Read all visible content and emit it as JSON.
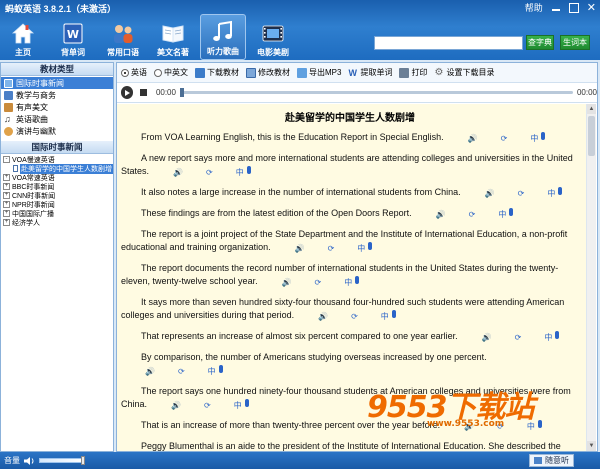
{
  "app": {
    "title": "蚂蚁英语 3.8.2.1（未激活）",
    "help": "帮助"
  },
  "toolbar": [
    {
      "label": "主页",
      "icon": "home-icon"
    },
    {
      "label": "背单词",
      "icon": "word-book-icon"
    },
    {
      "label": "常用口语",
      "icon": "people-chat-icon"
    },
    {
      "label": "美文名著",
      "icon": "book-icon"
    },
    {
      "label": "听力歌曲",
      "icon": "music-note-icon",
      "active": true
    },
    {
      "label": "电影美剧",
      "icon": "film-icon"
    }
  ],
  "search": {
    "placeholder": "",
    "btn_dict": "查字典",
    "btn_mood": "生词本"
  },
  "left": {
    "section_title": "教材类型",
    "categories": [
      {
        "label": "国际时事新闻",
        "selected": true
      },
      {
        "label": "教学与商务"
      },
      {
        "label": "有声美文"
      },
      {
        "label": "英语歌曲"
      },
      {
        "label": "演讲与幽默"
      }
    ],
    "section2_title": "国际时事新闻",
    "tree": [
      {
        "label": "VOA慢速英语",
        "expander": "-"
      },
      {
        "label": "赴美留学的中国学生人数剧增",
        "child": true
      },
      {
        "label": "VOA常速英语",
        "expander": "+"
      },
      {
        "label": "BBC时事新闻",
        "expander": "+"
      },
      {
        "label": "CNN时事新闻",
        "expander": "+"
      },
      {
        "label": "NPR时事新闻",
        "expander": "+"
      },
      {
        "label": "中国国际广播",
        "expander": "+"
      },
      {
        "label": "经济学人",
        "expander": "+"
      }
    ]
  },
  "options": {
    "radio_en": "英语",
    "radio_zh": "中英文",
    "download": "下载教材",
    "edit": "修改教材",
    "export": "导出MP3",
    "extract": "提取单词",
    "print": "打印",
    "settings": "设置下载目录"
  },
  "player": {
    "time_start": "00:00",
    "time_end": "00:00"
  },
  "article": {
    "title": "赴美留学的中国学生人数剧增",
    "ctrl_zh": "中",
    "paragraphs": [
      "From VOA Learning English, this is the Education Report in Special English.",
      "A new report says more and more international students are attending colleges and universities in the United States.",
      "It also notes a large increase in the number of international students from China.",
      "These findings are from the latest edition of the Open Doors Report.",
      "The report is a joint project of the State Department and the Institute of International Education, a non-profit educational and training organization.",
      "The report documents the record number of international students in the United States during the twenty-eleven, twenty-twelve school year.",
      "It says more than seven hundred sixty-four thousand four-hundred such students were attending American colleges and universities during that period.",
      "That represents an increase of almost six percent compared to one year earlier.",
      "By comparison, the number of Americans studying overseas increased by one percent.",
      "The report says one hundred ninety-four thousand students at American colleges and universities were from China.",
      "That is an increase of more than twenty-three percent over the year before.",
      "Peggy Blumenthal is an aide to the president of the Institute of International Education. She described the effect of the increase in Chinese students."
    ]
  },
  "watermark": {
    "big": "9553下载站",
    "small": "www.9553.com"
  },
  "status": {
    "volume_label": "音量",
    "feedback": "随意听"
  }
}
